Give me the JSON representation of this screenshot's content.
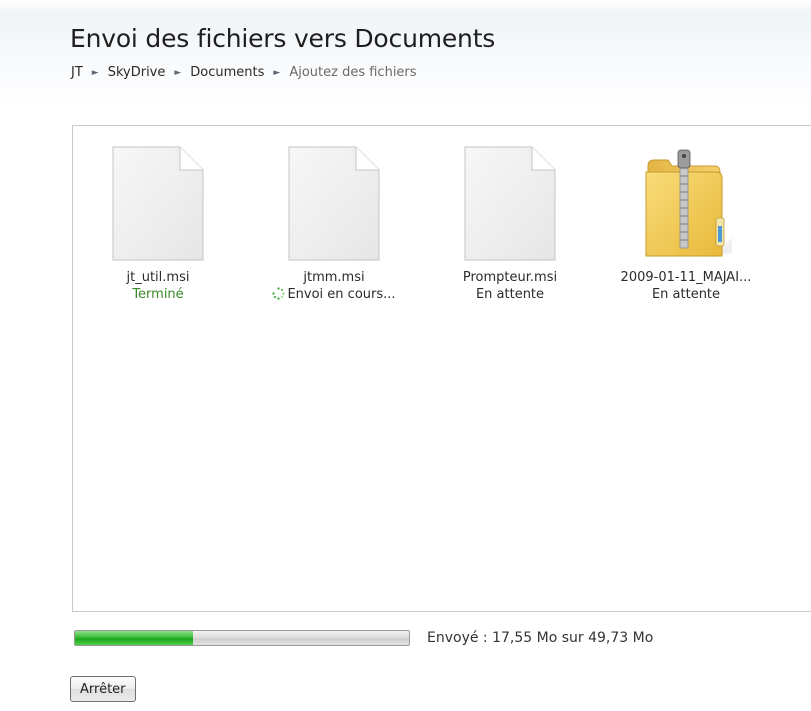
{
  "header": {
    "title": "Envoi des fichiers vers Documents"
  },
  "breadcrumb": {
    "items": [
      "JT",
      "SkyDrive",
      "Documents"
    ],
    "current": "Ajoutez des fichiers",
    "separator": "►"
  },
  "files": [
    {
      "name": "jt_util.msi",
      "status": "Terminé",
      "status_type": "done",
      "icon": "document-icon"
    },
    {
      "name": "jtmm.msi",
      "status": "Envoi en cours...",
      "status_type": "uploading",
      "icon": "document-icon"
    },
    {
      "name": "Prompteur.msi",
      "status": "En attente",
      "status_type": "pending",
      "icon": "document-icon"
    },
    {
      "name": "2009-01-11_MAJAI...",
      "status": "En attente",
      "status_type": "pending",
      "icon": "zip-folder-icon"
    }
  ],
  "progress": {
    "fraction": 0.3529,
    "text": "Envoyé : 17,55 Mo sur 49,73 Mo"
  },
  "actions": {
    "stop_label": "Arrêter"
  },
  "colors": {
    "done_status": "#3a8a2a",
    "progress_fill": "#2fb32d"
  }
}
